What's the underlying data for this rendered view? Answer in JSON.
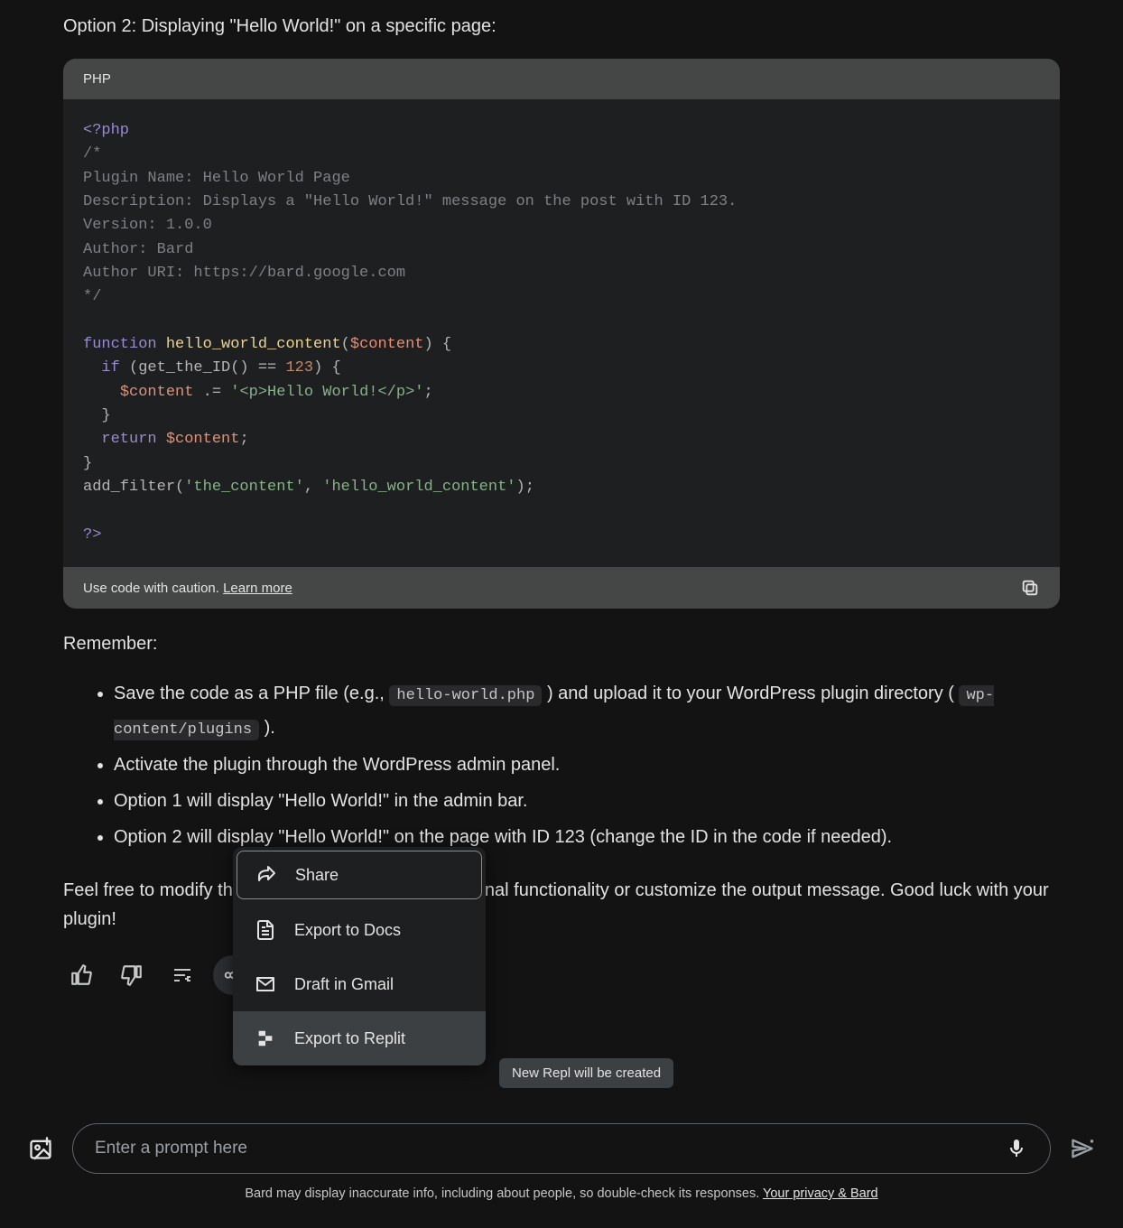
{
  "heading": "Option 2: Displaying \"Hello World!\" on a specific page:",
  "code": {
    "lang": "PHP",
    "caution": "Use code with caution.",
    "learn_more": "Learn more",
    "text": "<?php\n/*\nPlugin Name: Hello World Page\nDescription: Displays a \"Hello World!\" message on the post with ID 123.\nVersion: 1.0.0\nAuthor: Bard\nAuthor URI: https://bard.google.com\n*/\n\nfunction hello_world_content($content) {\n  if (get_the_ID() == 123) {\n    $content .= '<p>Hello World!</p>';\n  }\n  return $content;\n}\nadd_filter('the_content', 'hello_world_content');\n\n?>"
  },
  "remember": {
    "title": "Remember:",
    "items": [
      {
        "pre": "Save the code as a PHP file (e.g., ",
        "code1": "hello-world.php",
        "mid": " ) and upload it to your WordPress plugin directory ( ",
        "code2": "wp-content/plugins",
        "post": " )."
      },
      {
        "text": "Activate the plugin through the WordPress admin panel."
      },
      {
        "text": "Option 1 will display \"Hello World!\" in the admin bar."
      },
      {
        "text": "Option 2 will display \"Hello World!\" on the page with ID 123 (change the ID in the code if needed)."
      }
    ]
  },
  "closing": "Feel free to modify these examples to include additional functionality or customize the output message. Good luck with your plugin!",
  "popup": {
    "share": "Share",
    "export_docs": "Export to Docs",
    "draft_gmail": "Draft in Gmail",
    "export_replit": "Export to Replit"
  },
  "tooltip": "New Repl will be created",
  "input": {
    "placeholder": "Enter a prompt here"
  },
  "disclaimer": {
    "text": "Bard may display inaccurate info, including about people, so double-check its responses. ",
    "link": "Your privacy & Bard"
  }
}
